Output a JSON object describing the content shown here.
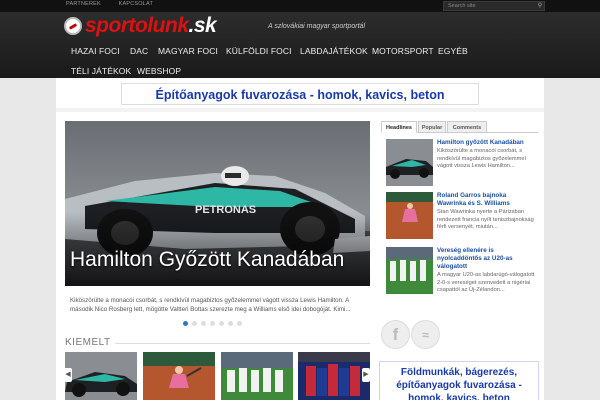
{
  "topbar": {
    "links": [
      "PARTNEREK",
      "KAPCSOLAT"
    ],
    "search_placeholder": "Search site"
  },
  "header": {
    "logo_main": "sportolunk",
    "logo_suffix": ".sk",
    "tagline": "A szlovákiai magyar sportportál"
  },
  "nav": {
    "items": [
      "HAZAI FOCI",
      "DAC",
      "MAGYAR FOCI",
      "KÜLFÖLDI FOCI",
      "LABDAJÁTÉKOK",
      "MOTORSPORT",
      "EGYÉB",
      "TÉLI JÁTÉKOK",
      "WEBSHOP"
    ]
  },
  "banner_top": "Építőanyagok fuvarozása - homok, kavics, beton",
  "slider": {
    "title": "Hamilton Győzött Kanadában",
    "text": "Kiköszörülte a monacói csorbát, s rendkívül magabiztos győzelemmel vágott vissza Lewis Hamilton. A második Nico Rosberg lett, mögötte Valtteri Bottas szerezte meg a Williams első idei dobogóját. Kimi...",
    "dot_count": 7,
    "active_dot": 0
  },
  "kiemelt": {
    "title": "KIEMELT"
  },
  "sidebar": {
    "tabs": [
      "Headlines",
      "Popular",
      "Comments"
    ],
    "active_tab": 0,
    "news": [
      {
        "title": "Hamilton győzött Kanadában",
        "text": "Kiköszörülte a monacói csorbát, s rendkívül magabiztos győzelemmel vágott vissza Lewis Hamilton..."
      },
      {
        "title": "Roland Garros bajnoka Wawrinka és S. Williams",
        "text": "Stan Wawrinka nyerte a Párizsban rendezett francia nyílt teniszbajnokság férfi versenyét, miután..."
      },
      {
        "title": "Vereség ellenére is nyolcaddöntős az U20-as válogatott",
        "text": "A magyar U20-as labdarúgó-válogatott 2-0-s vereséget szenvedett a nigériai csapattól az Új-Zélandon..."
      }
    ],
    "ad_text": "Földmunkák, bágerezés, építőanyagok fuvarozása - homok, kavics, beton"
  },
  "icons": {
    "social": [
      "facebook-icon",
      "rss-icon"
    ],
    "search": "search-icon"
  },
  "colors": {
    "brand_red": "#d11111",
    "link_blue": "#1a4fa3",
    "ad_blue": "#1a3aa8"
  }
}
